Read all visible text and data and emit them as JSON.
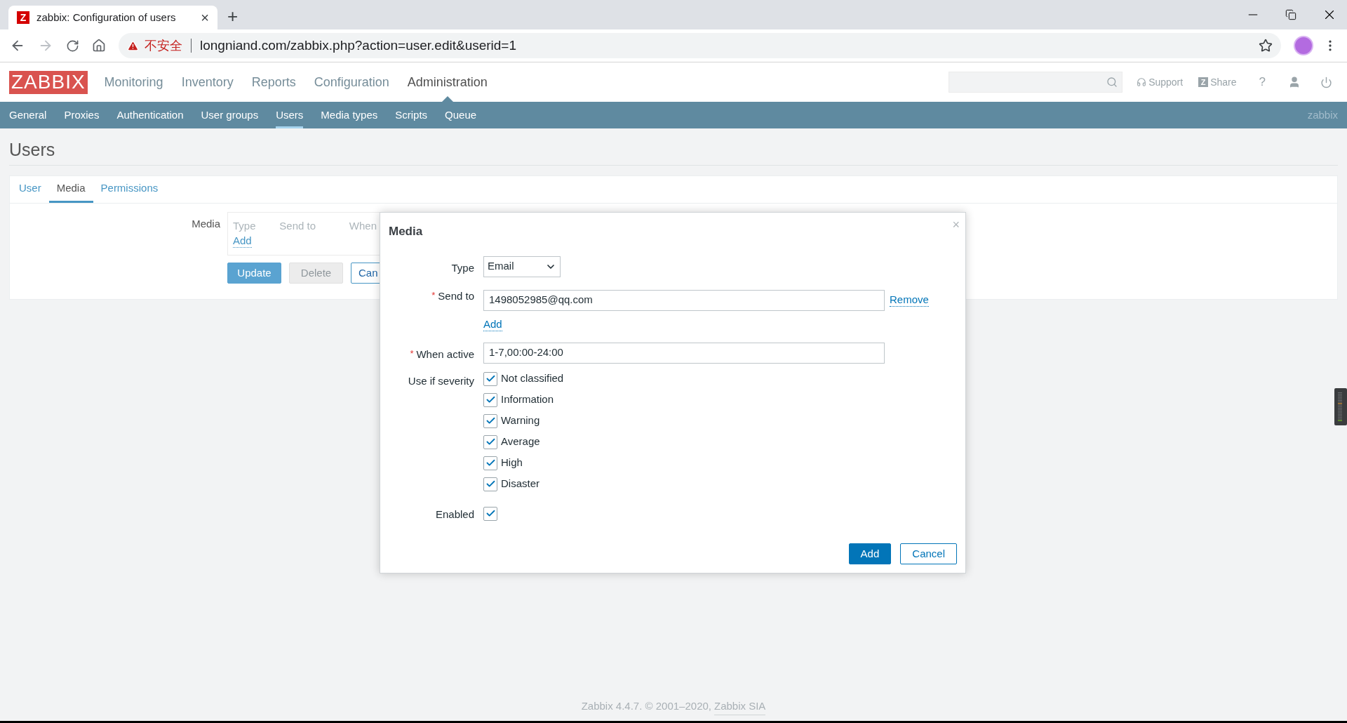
{
  "browser": {
    "tab": {
      "title": "zabbix: Configuration of users",
      "close": "×",
      "favicon": "Z"
    },
    "new_tab": "+",
    "security": "不安全",
    "url": "longniand.com/zabbix.php?action=user.edit&userid=1"
  },
  "header": {
    "logo": "ZABBIX",
    "menu": [
      {
        "label": "Monitoring",
        "selected": false
      },
      {
        "label": "Inventory",
        "selected": false
      },
      {
        "label": "Reports",
        "selected": false
      },
      {
        "label": "Configuration",
        "selected": false
      },
      {
        "label": "Administration",
        "selected": true
      }
    ],
    "links": [
      {
        "kind": "support",
        "label": "Support"
      },
      {
        "kind": "share",
        "label": "Share",
        "badge": "Z"
      }
    ],
    "help": "?"
  },
  "submenu": {
    "items": [
      {
        "label": "General",
        "selected": false
      },
      {
        "label": "Proxies",
        "selected": false
      },
      {
        "label": "Authentication",
        "selected": false
      },
      {
        "label": "User groups",
        "selected": false
      },
      {
        "label": "Users",
        "selected": true
      },
      {
        "label": "Media types",
        "selected": false
      },
      {
        "label": "Scripts",
        "selected": false
      },
      {
        "label": "Queue",
        "selected": false
      }
    ],
    "user": "zabbix"
  },
  "page": {
    "title": "Users",
    "tabs": [
      {
        "label": "User",
        "selected": false
      },
      {
        "label": "Media",
        "selected": true
      },
      {
        "label": "Permissions",
        "selected": false
      }
    ],
    "form": {
      "label": "Media",
      "columns": [
        "Type",
        "Send to",
        "When"
      ],
      "add_link": "Add",
      "buttons": [
        {
          "label": "Update",
          "kind": "primary"
        },
        {
          "label": "Delete",
          "kind": "disabled"
        },
        {
          "label": "Can",
          "kind": "secondary"
        }
      ]
    }
  },
  "dialog": {
    "title": "Media",
    "close": "×",
    "type": {
      "label": "Type",
      "value": "Email"
    },
    "send_to": {
      "label": "Send to",
      "required_mark": "*",
      "value": "1498052985@qq.com",
      "remove": "Remove",
      "add": "Add"
    },
    "when_active": {
      "label": "When active",
      "required_mark": "*",
      "value": "1-7,00:00-24:00"
    },
    "severity": {
      "label": "Use if severity",
      "options": [
        {
          "label": "Not classified",
          "checked": true
        },
        {
          "label": "Information",
          "checked": true
        },
        {
          "label": "Warning",
          "checked": true
        },
        {
          "label": "Average",
          "checked": true
        },
        {
          "label": "High",
          "checked": true
        },
        {
          "label": "Disaster",
          "checked": true
        }
      ]
    },
    "enabled": {
      "label": "Enabled",
      "checked": true
    },
    "buttons": [
      {
        "label": "Add",
        "kind": "primary"
      },
      {
        "label": "Cancel",
        "kind": "secondary"
      }
    ]
  },
  "footer": {
    "text": "Zabbix 4.4.7. © 2001–2020,",
    "link": "Zabbix SIA"
  }
}
